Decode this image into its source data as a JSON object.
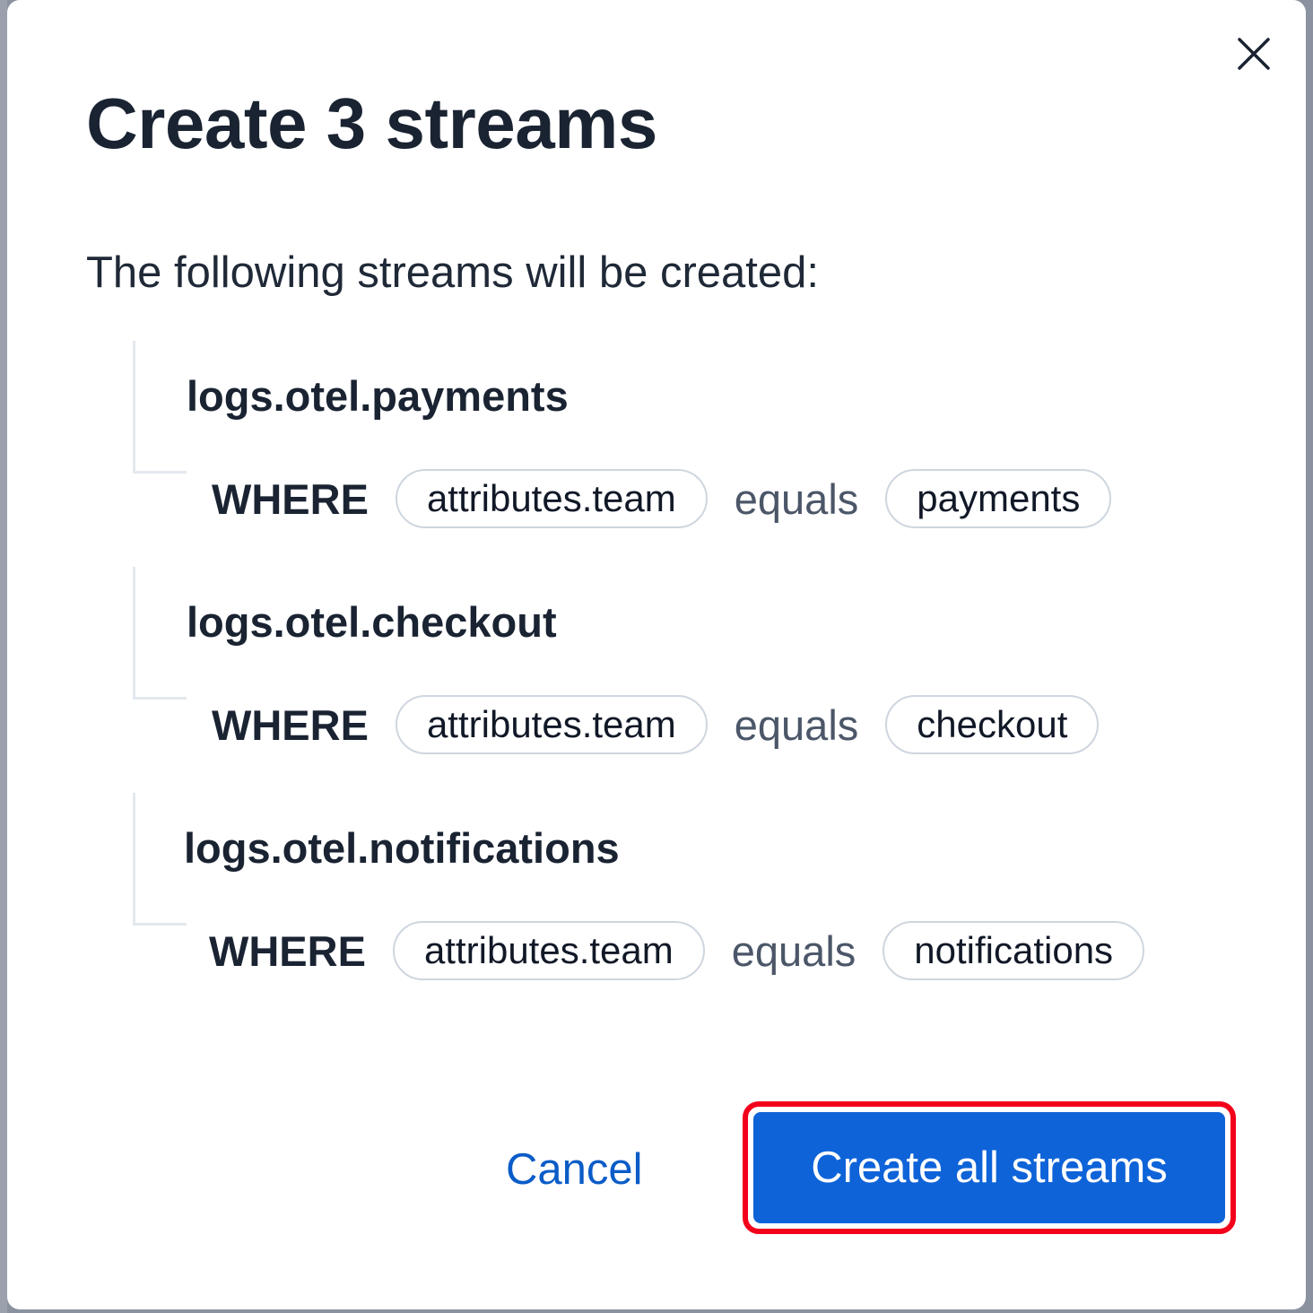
{
  "modal": {
    "title": "Create 3 streams",
    "intro": "The following streams will be created:",
    "close_icon": "close-icon",
    "streams": [
      {
        "name": "logs.otel.payments",
        "keyword": "WHERE",
        "field": "attributes.team",
        "operator": "equals",
        "value": "payments"
      },
      {
        "name": "logs.otel.checkout",
        "keyword": "WHERE",
        "field": "attributes.team",
        "operator": "equals",
        "value": "checkout"
      },
      {
        "name": "logs.otel.notifications",
        "keyword": "WHERE",
        "field": "attributes.team",
        "operator": "equals",
        "value": "notifications"
      }
    ],
    "cancel_label": "Cancel",
    "confirm_label": "Create all streams"
  },
  "colors": {
    "primary": "#0e63d8",
    "highlight": "#f2001c",
    "text": "#1a2332",
    "link": "#0b5cc7"
  }
}
